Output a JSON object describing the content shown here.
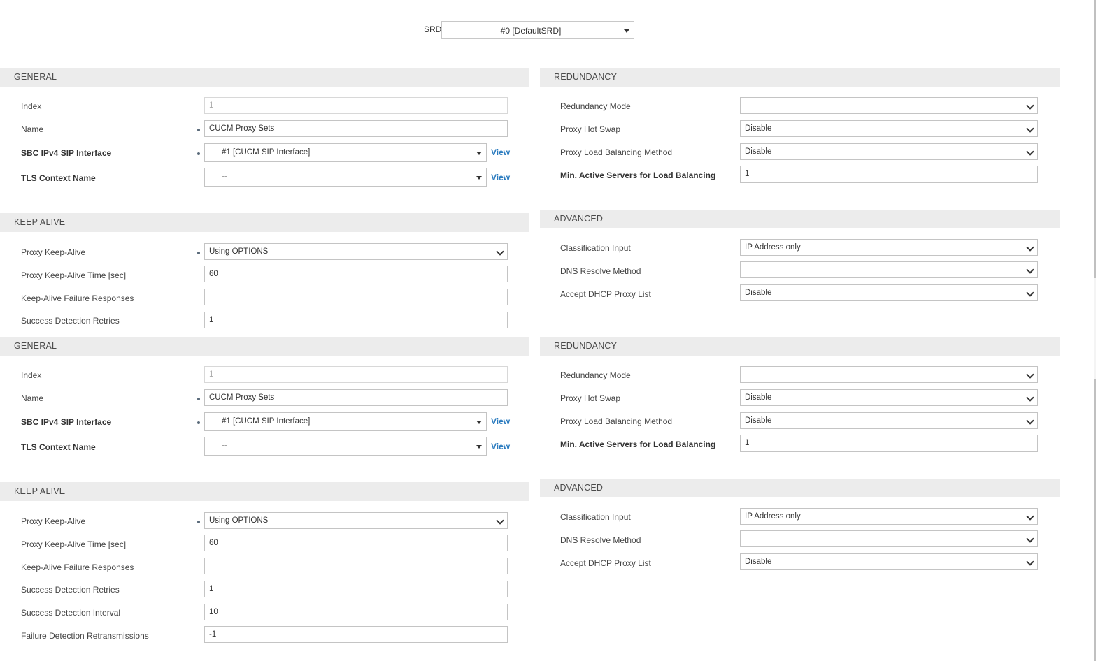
{
  "srd": {
    "label": "SRD",
    "value": "#0 [DefaultSRD]"
  },
  "block1": {
    "general": {
      "title": "GENERAL",
      "index_label": "Index",
      "index_value": "1",
      "name_label": "Name",
      "name_value": "CUCM Proxy Sets",
      "sip_if_label": "SBC IPv4 SIP Interface",
      "sip_if_value": "#1 [CUCM SIP Interface]",
      "tls_label": "TLS Context Name",
      "tls_value": "--",
      "view_label": "View"
    },
    "redundancy": {
      "title": "REDUNDANCY",
      "mode_label": "Redundancy Mode",
      "mode_value": "",
      "hotswap_label": "Proxy Hot Swap",
      "hotswap_value": "Disable",
      "lb_label": "Proxy Load Balancing Method",
      "lb_value": "Disable",
      "minactive_label": "Min. Active Servers for Load Balancing",
      "minactive_value": "1"
    },
    "keepalive": {
      "title": "KEEP ALIVE",
      "ka_label": "Proxy Keep-Alive",
      "ka_value": "Using OPTIONS",
      "katime_label": "Proxy Keep-Alive Time [sec]",
      "katime_value": "60",
      "kafail_label": "Keep-Alive Failure Responses",
      "kafail_value": "",
      "retries_label": "Success Detection Retries",
      "retries_value": "1"
    },
    "advanced": {
      "title": "ADVANCED",
      "class_label": "Classification Input",
      "class_value": "IP Address only",
      "dns_label": "DNS Resolve Method",
      "dns_value": "",
      "dhcp_label": "Accept DHCP Proxy List",
      "dhcp_value": "Disable"
    }
  },
  "block2": {
    "general": {
      "title": "GENERAL",
      "index_label": "Index",
      "index_value": "1",
      "name_label": "Name",
      "name_value": "CUCM Proxy Sets",
      "sip_if_label": "SBC IPv4 SIP Interface",
      "sip_if_value": "#1 [CUCM SIP Interface]",
      "tls_label": "TLS Context Name",
      "tls_value": "--",
      "view_label": "View"
    },
    "redundancy": {
      "title": "REDUNDANCY",
      "mode_label": "Redundancy Mode",
      "mode_value": "",
      "hotswap_label": "Proxy Hot Swap",
      "hotswap_value": "Disable",
      "lb_label": "Proxy Load Balancing Method",
      "lb_value": "Disable",
      "minactive_label": "Min. Active Servers for Load Balancing",
      "minactive_value": "1"
    },
    "keepalive": {
      "title": "KEEP ALIVE",
      "ka_label": "Proxy Keep-Alive",
      "ka_value": "Using OPTIONS",
      "katime_label": "Proxy Keep-Alive Time [sec]",
      "katime_value": "60",
      "kafail_label": "Keep-Alive Failure Responses",
      "kafail_value": "",
      "retries_label": "Success Detection Retries",
      "retries_value": "1",
      "interval_label": "Success Detection Interval",
      "interval_value": "10",
      "retrans_label": "Failure Detection Retransmissions",
      "retrans_value": "-1"
    },
    "advanced": {
      "title": "ADVANCED",
      "class_label": "Classification Input",
      "class_value": "IP Address only",
      "dns_label": "DNS Resolve Method",
      "dns_value": "",
      "dhcp_label": "Accept DHCP Proxy List",
      "dhcp_value": "Disable"
    }
  }
}
